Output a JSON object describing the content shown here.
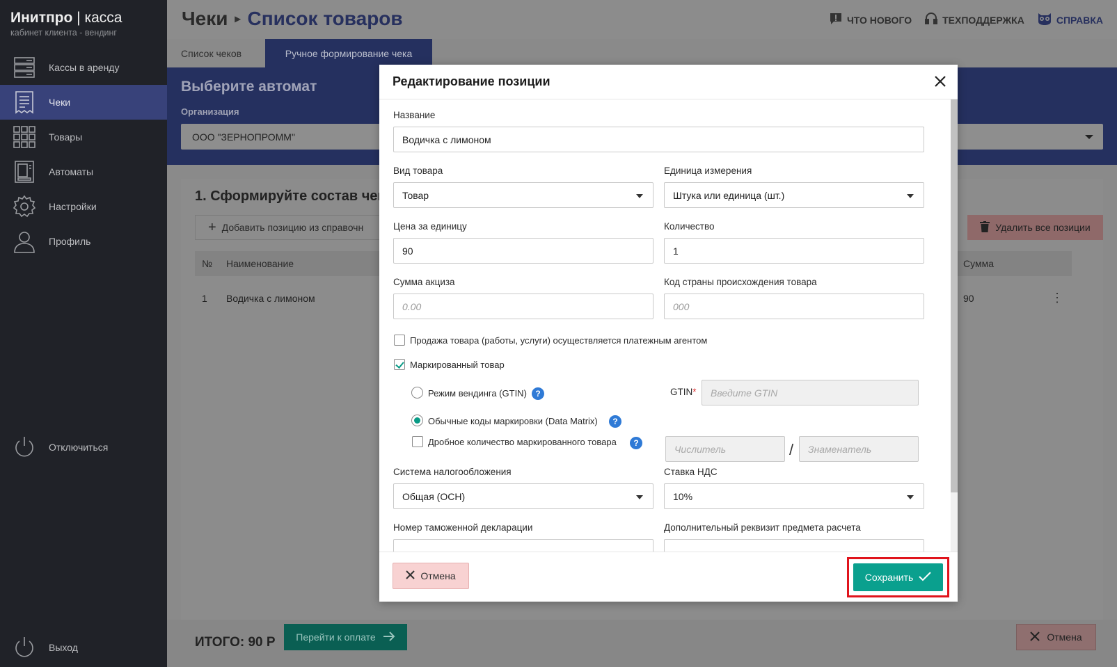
{
  "brand": {
    "title_bold": "Инитпро",
    "title_sep": " | ",
    "title_rest": "касса",
    "subtitle": "кабинет клиента - вендинг"
  },
  "sidebar": {
    "items": [
      {
        "label": "Кассы в аренду",
        "icon": "server-icon"
      },
      {
        "label": "Чеки",
        "icon": "receipt-icon"
      },
      {
        "label": "Товары",
        "icon": "grid-icon"
      },
      {
        "label": "Автоматы",
        "icon": "vending-machine-icon"
      },
      {
        "label": "Настройки",
        "icon": "gear-icon"
      },
      {
        "label": "Профиль",
        "icon": "user-icon"
      }
    ],
    "disconnect": "Отключиться",
    "logout": "Выход"
  },
  "header": {
    "crumb1": "Чеки",
    "crumb2": "Список товаров",
    "links": {
      "news": "ЧТО НОВОГО",
      "support": "ТЕХПОДДЕРЖКА",
      "help": "СПРАВКА"
    }
  },
  "tabs": {
    "tab1": "Список чеков",
    "tab2": "Ручное формирование чека"
  },
  "band": {
    "title": "Выберите автомат",
    "org_label": "Организация",
    "org_value": "ООО \"ЗЕРНОПРОММ\""
  },
  "card": {
    "step_title": "1. Сформируйте состав чек",
    "add_btn": "Добавить позицию из справочн",
    "delete_all": "Удалить все позиции",
    "columns": {
      "num": "№",
      "name": "Наименование",
      "sum": "Сумма"
    },
    "row": {
      "num": "1",
      "name": "Водичка с лимоном",
      "sum": "90"
    }
  },
  "footer": {
    "total": "ИТОГО: 90 Р",
    "pay": "Перейти к оплате",
    "cancel": "Отмена"
  },
  "modal": {
    "title": "Редактирование позиции",
    "name_label": "Название",
    "name_value": "Водичка с лимоном",
    "kind_label": "Вид товара",
    "kind_value": "Товар",
    "unit_label": "Единица измерения",
    "unit_value": "Штука или единица (шт.)",
    "price_label": "Цена за единицу",
    "price_value": "90",
    "qty_label": "Количество",
    "qty_value": "1",
    "excise_label": "Сумма акциза",
    "excise_placeholder": "0.00",
    "country_label": "Код страны происхождения товара",
    "country_placeholder": "000",
    "agent_label": "Продажа товара (работы, услуги) осуществляется платежным агентом",
    "marked_label": "Маркированный товар",
    "vending_mode": "Режим вендинга (GTIN)",
    "gtin_label": "GTIN",
    "gtin_placeholder": "Введите GTIN",
    "datamatrix_mode": "Обычные коды маркировки (Data Matrix)",
    "fractional_label": "Дробное количество маркированного товара",
    "numerator_placeholder": "Числитель",
    "denominator_placeholder": "Знаменатель",
    "tax_label": "Система налогообложения",
    "tax_value": "Общая (ОСН)",
    "vat_label": "Ставка НДС",
    "vat_value": "10%",
    "customs_label": "Номер таможенной декларации",
    "extra_label": "Дополнительный реквизит предмета расчета",
    "cancel": "Отмена",
    "save": "Сохранить"
  }
}
